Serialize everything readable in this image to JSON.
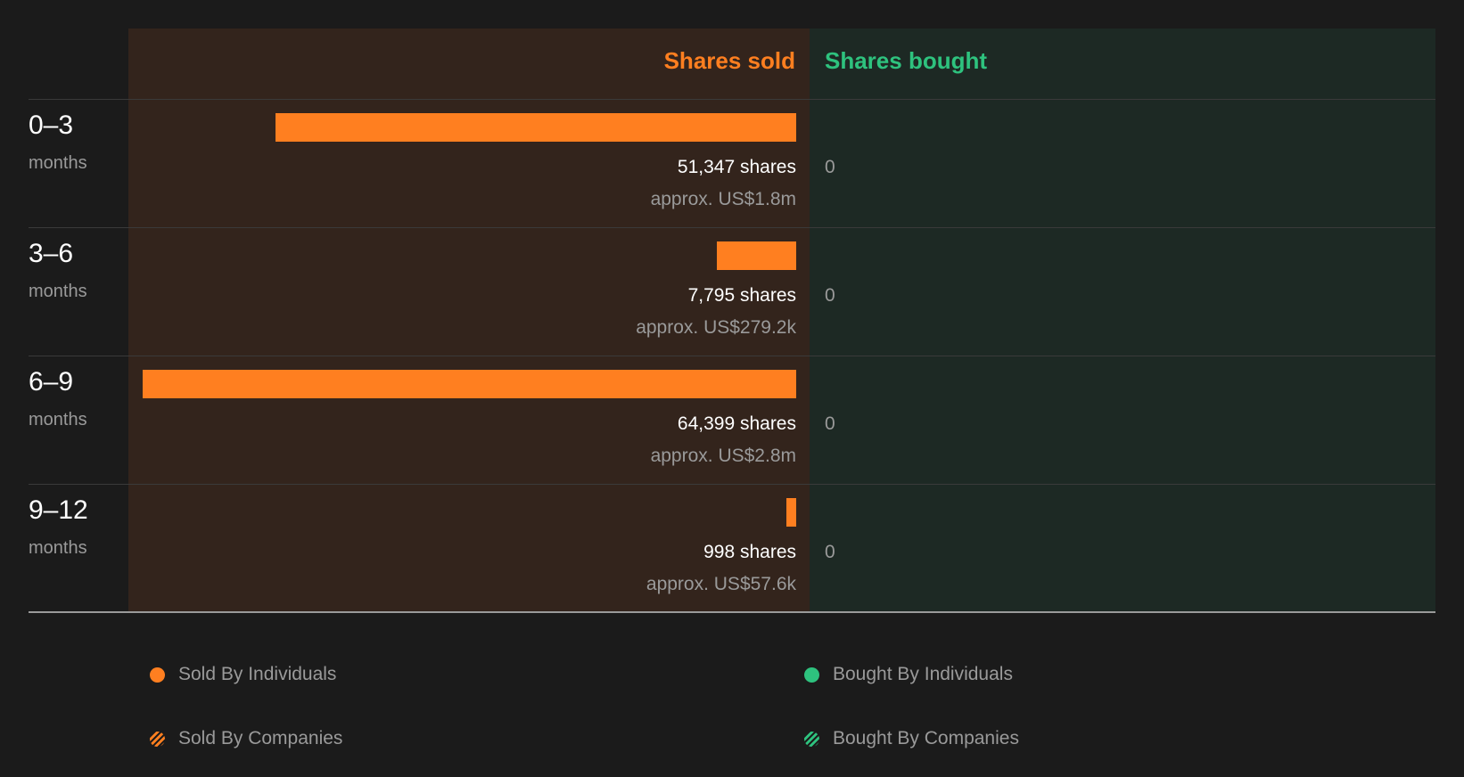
{
  "chart_data": {
    "type": "bar",
    "orientation": "horizontal-diverging",
    "columns": {
      "sold_label": "Shares sold",
      "bought_label": "Shares bought"
    },
    "rows": [
      {
        "period": "0–3",
        "unit": "months",
        "sold": 51347,
        "sold_label": "51,347 shares",
        "sold_value": "approx. US$1.8m",
        "bought": 0,
        "bought_label": "0"
      },
      {
        "period": "3–6",
        "unit": "months",
        "sold": 7795,
        "sold_label": "7,795 shares",
        "sold_value": "approx. US$279.2k",
        "bought": 0,
        "bought_label": "0"
      },
      {
        "period": "6–9",
        "unit": "months",
        "sold": 64399,
        "sold_label": "64,399 shares",
        "sold_value": "approx. US$2.8m",
        "bought": 0,
        "bought_label": "0"
      },
      {
        "period": "9–12",
        "unit": "months",
        "sold": 998,
        "sold_label": "998 shares",
        "sold_value": "approx. US$57.6k",
        "bought": 0,
        "bought_label": "0"
      }
    ],
    "legend": [
      {
        "label": "Sold By Individuals",
        "color": "#ff7f20",
        "style": "solid"
      },
      {
        "label": "Bought By Individuals",
        "color": "#2ec27e",
        "style": "solid"
      },
      {
        "label": "Sold By Companies",
        "color": "#ff7f20",
        "style": "hatched"
      },
      {
        "label": "Bought By Companies",
        "color": "#2ec27e",
        "style": "hatched"
      }
    ]
  },
  "colors": {
    "sold": "#ff7f20",
    "bought": "#2ec27e",
    "sold_bg": "#33241c",
    "bought_bg": "#1d2924",
    "background": "#1b1b1b"
  }
}
